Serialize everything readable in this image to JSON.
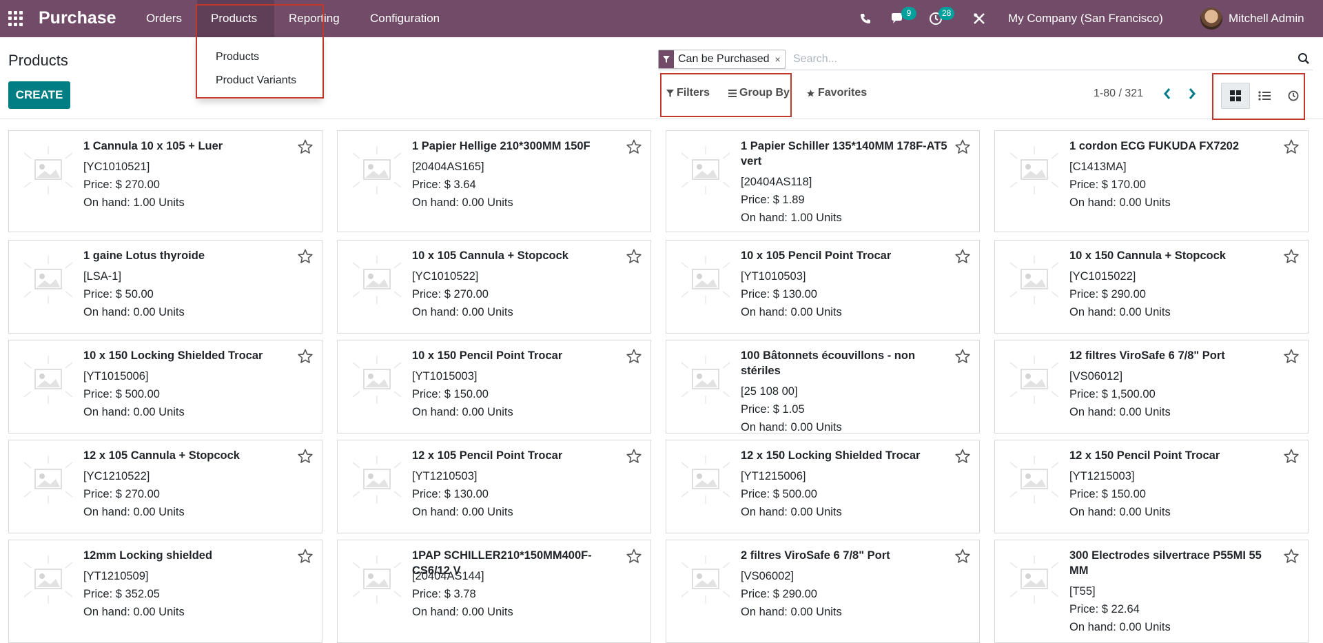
{
  "navbar": {
    "brand": "Purchase",
    "menu": {
      "orders": "Orders",
      "products": "Products",
      "reporting": "Reporting",
      "configuration": "Configuration"
    },
    "messages_count": "9",
    "activities_count": "28",
    "company": "My Company (San Francisco)",
    "user": "Mitchell Admin"
  },
  "dropdown": {
    "items": [
      "Products",
      "Product Variants"
    ]
  },
  "control_panel": {
    "title": "Products",
    "create_label": "CREATE",
    "facet_label": "Can be Purchased",
    "facet_close": "×",
    "search_placeholder": "Search...",
    "filters_label": "Filters",
    "group_by_label": "Group By",
    "favorites_label": "Favorites",
    "pager": "1-80 / 321"
  },
  "products": [
    {
      "name": "1 Cannula 10 x 105 + Luer",
      "ref": "[YC1010521]",
      "price": "Price: $ 270.00",
      "onhand": "On hand: 1.00 Units"
    },
    {
      "name": "1 Papier Hellige 210*300MM 150F",
      "ref": "[20404AS165]",
      "price": "Price: $ 3.64",
      "onhand": "On hand: 0.00 Units"
    },
    {
      "name": "1 Papier Schiller 135*140MM 178F-AT5 vert",
      "ref": "[20404AS118]",
      "price": "Price: $ 1.89",
      "onhand": "On hand: 1.00 Units"
    },
    {
      "name": "1 cordon ECG FUKUDA FX7202",
      "ref": "[C1413MA]",
      "price": "Price: $ 170.00",
      "onhand": "On hand: 0.00 Units"
    },
    {
      "name": "1 gaine Lotus thyroide",
      "ref": "[LSA-1]",
      "price": "Price: $ 50.00",
      "onhand": "On hand: 0.00 Units"
    },
    {
      "name": "10 x 105 Cannula + Stopcock",
      "ref": "[YC1010522]",
      "price": "Price: $ 270.00",
      "onhand": "On hand: 0.00 Units"
    },
    {
      "name": "10 x 105 Pencil Point Trocar",
      "ref": "[YT1010503]",
      "price": "Price: $ 130.00",
      "onhand": "On hand: 0.00 Units"
    },
    {
      "name": "10 x 150 Cannula + Stopcock",
      "ref": "[YC1015022]",
      "price": "Price: $ 290.00",
      "onhand": "On hand: 0.00 Units"
    },
    {
      "name": "10 x 150 Locking Shielded Trocar",
      "ref": "[YT1015006]",
      "price": "Price: $ 500.00",
      "onhand": "On hand: 0.00 Units"
    },
    {
      "name": "10 x 150 Pencil Point Trocar",
      "ref": "[YT1015003]",
      "price": "Price: $ 150.00",
      "onhand": "On hand: 0.00 Units"
    },
    {
      "name": "100 Bâtonnets écouvillons - non stériles",
      "ref": "[25 108 00]",
      "price": "Price: $ 1.05",
      "onhand": "On hand: 0.00 Units"
    },
    {
      "name": "12 filtres ViroSafe 6 7/8\" Port",
      "ref": "[VS06012]",
      "price": "Price: $ 1,500.00",
      "onhand": "On hand: 0.00 Units"
    },
    {
      "name": "12 x 105 Cannula + Stopcock",
      "ref": "[YC1210522]",
      "price": "Price: $ 270.00",
      "onhand": "On hand: 0.00 Units"
    },
    {
      "name": "12 x 105 Pencil Point Trocar",
      "ref": "[YT1210503]",
      "price": "Price: $ 130.00",
      "onhand": "On hand: 0.00 Units"
    },
    {
      "name": "12 x 150 Locking Shielded Trocar",
      "ref": "[YT1215006]",
      "price": "Price: $ 500.00",
      "onhand": "On hand: 0.00 Units"
    },
    {
      "name": "12 x 150 Pencil Point Trocar",
      "ref": "[YT1215003]",
      "price": "Price: $ 150.00",
      "onhand": "On hand: 0.00 Units"
    },
    {
      "name": "12mm Locking shielded",
      "ref": "[YT1210509]",
      "price": "Price: $ 352.05",
      "onhand": "On hand: 0.00 Units"
    },
    {
      "name": "1PAP SCHILLER210*150MM400F-CS6/12 V",
      "ref": "[20404AS144]",
      "price": "Price: $ 3.78",
      "onhand": "On hand: 0.00 Units"
    },
    {
      "name": "2 filtres ViroSafe 6 7/8\" Port",
      "ref": "[VS06002]",
      "price": "Price: $ 290.00",
      "onhand": "On hand: 0.00 Units"
    },
    {
      "name": "300 Electrodes silvertrace P55MI 55 MM",
      "ref": "[T55]",
      "price": "Price: $ 22.64",
      "onhand": "On hand: 0.00 Units"
    }
  ]
}
